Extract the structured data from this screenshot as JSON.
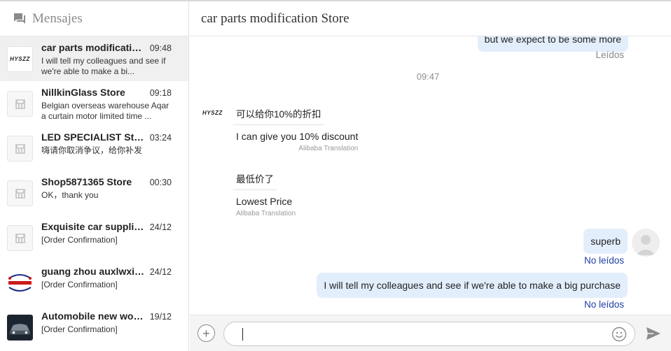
{
  "sidebar": {
    "title": "Mensajes",
    "conversations": [
      {
        "name": "car parts modification Store",
        "time": "09:48",
        "preview": "I will tell my colleagues and see if we're able to make a bi...",
        "avatar": "HYSZZ",
        "avatar_type": "logo",
        "active": true
      },
      {
        "name": "NillkinGlass Store",
        "time": "09:18",
        "preview": "Belgian overseas warehouse Aqar a curtain motor limited time ...",
        "avatar_type": "store"
      },
      {
        "name": "LED SPECIALIST Store",
        "time": "03:24",
        "preview": "嗨请你取消争议，给你补发",
        "avatar_type": "store"
      },
      {
        "name": "Shop5871365 Store",
        "time": "00:30",
        "preview": "OK，thank you",
        "avatar_type": "store"
      },
      {
        "name": "Exquisite car supplies Store",
        "time": "24/12",
        "preview": "[Order Confirmation]",
        "avatar_type": "store"
      },
      {
        "name": "guang zhou auxlwxi Store",
        "time": "24/12",
        "preview": "[Order Confirmation]",
        "avatar_type": "brand"
      },
      {
        "name": "Automobile new world Store",
        "time": "19/12",
        "preview": "[Order Confirmation]",
        "avatar_type": "car"
      }
    ]
  },
  "chat": {
    "title": "car parts modification Store",
    "partial_message": "but we expect to be some more",
    "status_read": "Leídos",
    "time_separator": "09:47",
    "incoming_avatar": "HYSZZ",
    "incoming": [
      {
        "original": "可以给你10%的折扣",
        "translation": "I can give you 10% discount",
        "by": "Alibaba Translation"
      },
      {
        "original": "最低价了",
        "translation": "Lowest Price",
        "by": "Alibaba Translation"
      }
    ],
    "outgoing": [
      {
        "text": "superb",
        "status": "No leídos"
      },
      {
        "text": "I will tell my colleagues and see if we're able to make a big purchase",
        "status": "No leídos"
      }
    ]
  },
  "composer": {
    "placeholder": "",
    "value": ""
  },
  "colors": {
    "outgoing_bubble": "#e3eefc",
    "unread_status": "#1f3fa5",
    "active_conversation": "#f0f0f0"
  }
}
